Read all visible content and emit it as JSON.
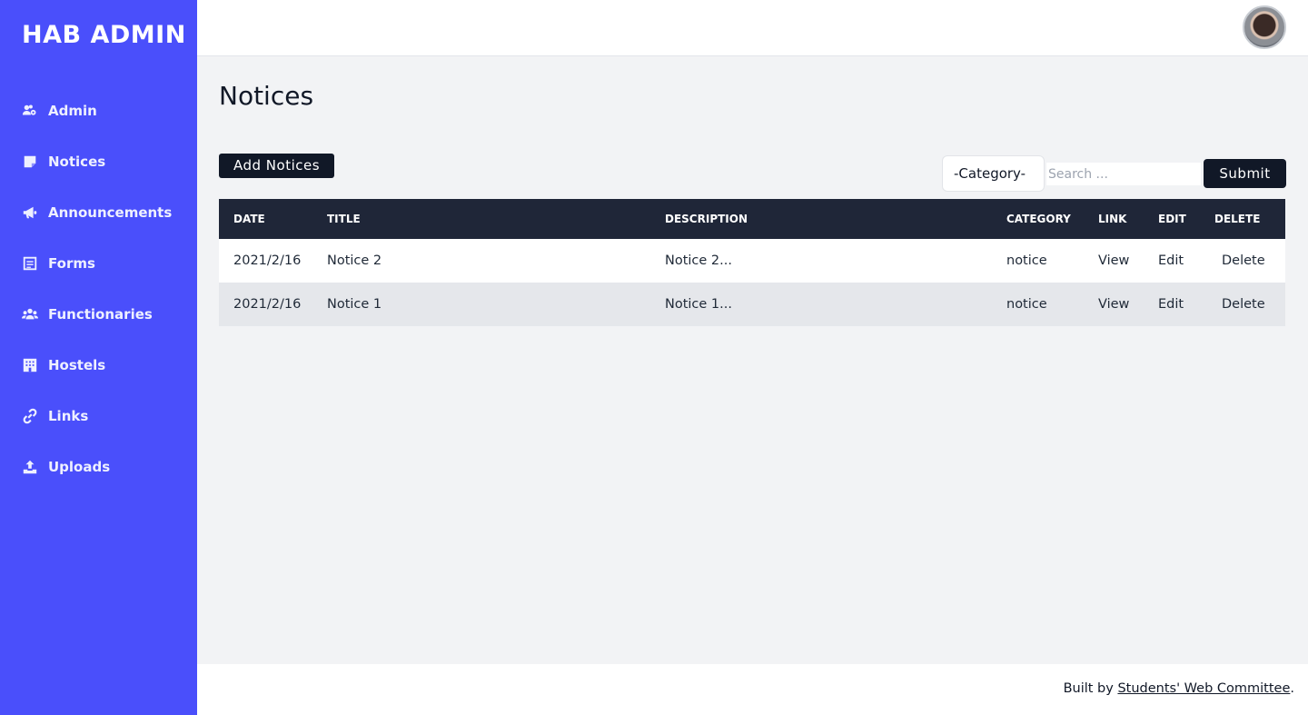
{
  "sidebar": {
    "brand": "HAB ADMIN",
    "items": [
      {
        "label": "Admin",
        "icon": "users-cog-icon"
      },
      {
        "label": "Notices",
        "icon": "sticky-note-icon"
      },
      {
        "label": "Announcements",
        "icon": "megaphone-icon"
      },
      {
        "label": "Forms",
        "icon": "form-icon"
      },
      {
        "label": "Functionaries",
        "icon": "users-icon"
      },
      {
        "label": "Hostels",
        "icon": "building-icon"
      },
      {
        "label": "Links",
        "icon": "link-icon"
      },
      {
        "label": "Uploads",
        "icon": "upload-icon"
      }
    ]
  },
  "topbar": {
    "avatar": "user-avatar"
  },
  "main": {
    "title": "Notices",
    "add_button": "Add Notices",
    "category_select": "-Category-",
    "search_placeholder": "Search ...",
    "submit_button": "Submit"
  },
  "table": {
    "headers": [
      "DATE",
      "TITLE",
      "DESCRIPTION",
      "CATEGORY",
      "LINK",
      "EDIT",
      "DELETE"
    ],
    "rows": [
      {
        "date": "2021/2/16",
        "title": "Notice 2",
        "description": "Notice 2...",
        "category": "notice",
        "link": "View",
        "edit": "Edit",
        "delete": "Delete"
      },
      {
        "date": "2021/2/16",
        "title": "Notice 1",
        "description": "Notice 1...",
        "category": "notice",
        "link": "View",
        "edit": "Edit",
        "delete": "Delete"
      }
    ]
  },
  "footer": {
    "prefix": "Built by ",
    "link": "Students' Web Committee",
    "suffix": "."
  },
  "colors": {
    "sidebar": "#4a4ffb",
    "header_row": "#1f2638",
    "button": "#111827",
    "background": "#f2f3f5"
  }
}
